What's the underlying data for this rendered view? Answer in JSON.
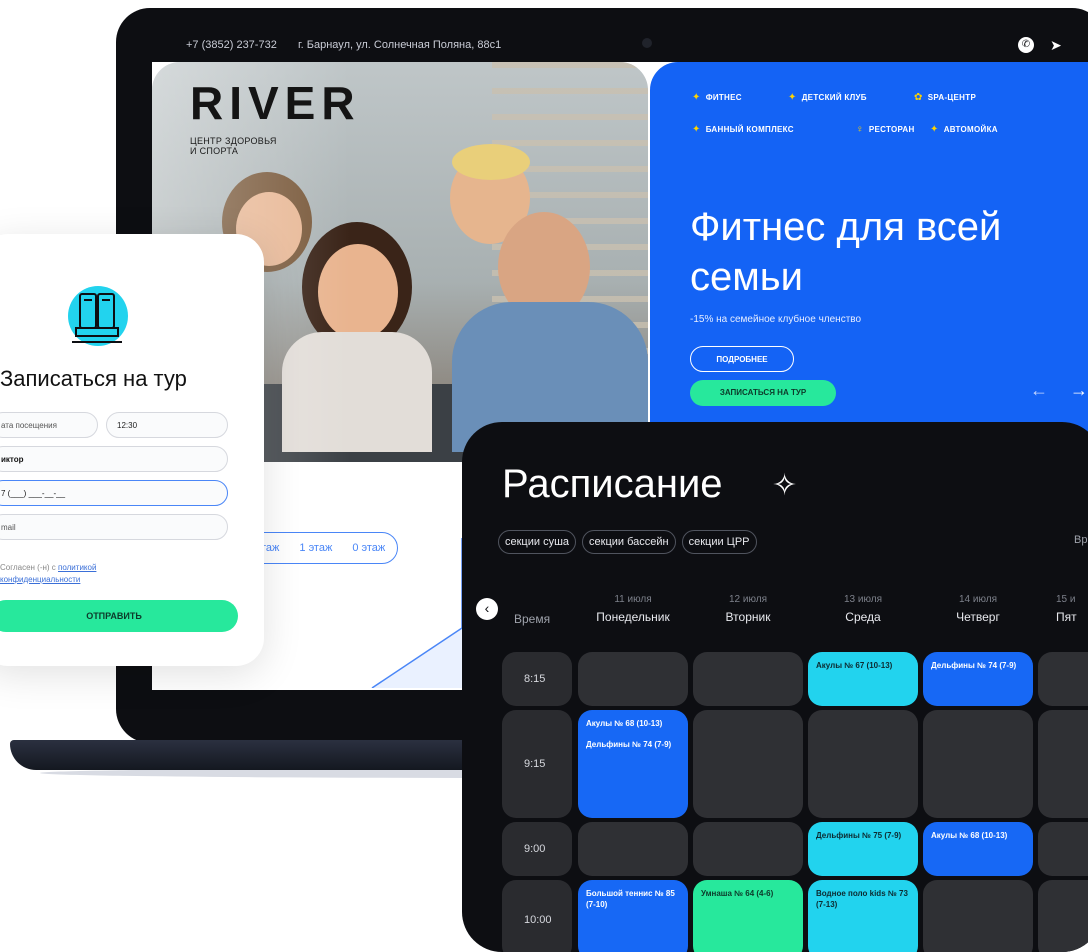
{
  "site": {
    "phone": "+7 (3852) 237-732",
    "address": "г. Барнаул, ул. Солнечная Поляна, 88с1",
    "logo": "RIVER",
    "logo_subtitle_line1": "ЦЕНТР ЗДОРОВЬЯ",
    "logo_subtitle_line2": "И СПОРТА",
    "nav": [
      "ФИТНЕС",
      "ДЕТСКИЙ КЛУБ",
      "SPA-ЦЕНТР",
      "БАННЫЙ КОМПЛЕКС",
      "РЕСТОРАН",
      "АВТОМОЙКА"
    ],
    "hero_title_line1": "Фитнес для всей",
    "hero_title_line2": "семьи",
    "hero_subtitle": "-15% на семейное клубное членство",
    "more_button": "ПОДРОБНЕЕ",
    "tour_button": "ЗАПИСАТЬСЯ НА ТУР",
    "floors": [
      "таж",
      "1 этаж",
      "0 этаж"
    ]
  },
  "form": {
    "title": "Записаться на тур",
    "date_placeholder": "ата посещения",
    "time_value": "12:30",
    "name_value": "иктор",
    "phone_value": "7 (___) ___-__-__",
    "email_placeholder": "mail",
    "agree_text": "Согласен (-н) с ",
    "agree_link1": "политикой",
    "agree_link2": "конфиденциальности",
    "submit": "ОТПРАВИТЬ"
  },
  "schedule": {
    "title": "Расписание",
    "star": "✧",
    "chips": [
      "секции суша",
      "секции бассейн",
      "секции ЦРР"
    ],
    "chip_cut": "Вр",
    "time_header": "Время",
    "columns": [
      {
        "date": "11 июля",
        "day": "Понедельник"
      },
      {
        "date": "12 июля",
        "day": "Вторник"
      },
      {
        "date": "13 июля",
        "day": "Среда"
      },
      {
        "date": "14 июля",
        "day": "Четверг"
      },
      {
        "date": "15 и",
        "day": "Пят"
      }
    ],
    "times": [
      "8:15",
      "9:15",
      "9:00",
      "10:00"
    ],
    "events": {
      "r0c2": "Акулы № 67 (10-13)",
      "r0c3": "Дельфины № 74 (7-9)",
      "r1c0a": "Акулы № 68 (10-13)",
      "r1c0b": "Дельфины № 74 (7-9)",
      "r2c2": "Дельфины № 75 (7-9)",
      "r2c3": "Акулы № 68 (10-13)",
      "r3c0": "Большой теннис № 85 (7-10)",
      "r3c1": "Умнаша № 64 (4-6)",
      "r3c2": "Водное поло kids № 73 (7-13)"
    }
  },
  "colors": {
    "brand_blue": "#1463f5",
    "accent_green": "#27e89c",
    "cyan": "#22d3ee",
    "dark": "#0d0e12"
  }
}
